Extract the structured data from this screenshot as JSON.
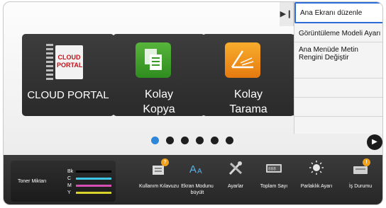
{
  "tiles": [
    {
      "label": "CLOUD PORTAL",
      "logo_text": [
        "CLOUD",
        "PORTAL"
      ],
      "icon": "cloud-portal-logo"
    },
    {
      "label": "Kolay Kopya",
      "icon": "copy-icon",
      "color": "#3ea32b"
    },
    {
      "label": "Kolay Tarama",
      "icon": "scan-icon",
      "color": "#f0921e"
    }
  ],
  "side_menu": {
    "collapse_icon": "collapse-arrow-icon",
    "items": [
      {
        "label": "Ana Ekranı düzenle"
      },
      {
        "label": "Görüntüleme Modeli Ayarı"
      },
      {
        "label": "Ana Menüde Metin Rengini Değiştir"
      }
    ]
  },
  "pager": {
    "count": 6,
    "active": 0,
    "next_icon": "next-page-icon"
  },
  "toner": {
    "label": "Toner Miktarı",
    "levels": [
      {
        "name": "Bk",
        "color": "#000000"
      },
      {
        "name": "C",
        "color": "#3fc6e6"
      },
      {
        "name": "M",
        "color": "#d64fb2"
      },
      {
        "name": "Y",
        "color": "#d9d22a"
      }
    ]
  },
  "functions": [
    {
      "label": "Kullanım Kılavuzu",
      "icon": "manual-icon",
      "badge": "?"
    },
    {
      "label": "Ekran Modunu büyült",
      "icon": "enlarge-text-icon"
    },
    {
      "label": "Ayarlar",
      "icon": "settings-tools-icon"
    },
    {
      "label": "Toplam Sayı",
      "icon": "counter-icon"
    },
    {
      "label": "Parlaklık Ayarı",
      "icon": "brightness-icon"
    },
    {
      "label": "İş Durumu",
      "icon": "job-status-icon",
      "badge": "!"
    }
  ],
  "colors": {
    "accent": "#2d86d9",
    "selected_border": "#2b6cd8",
    "badge": "#f2a11a"
  }
}
